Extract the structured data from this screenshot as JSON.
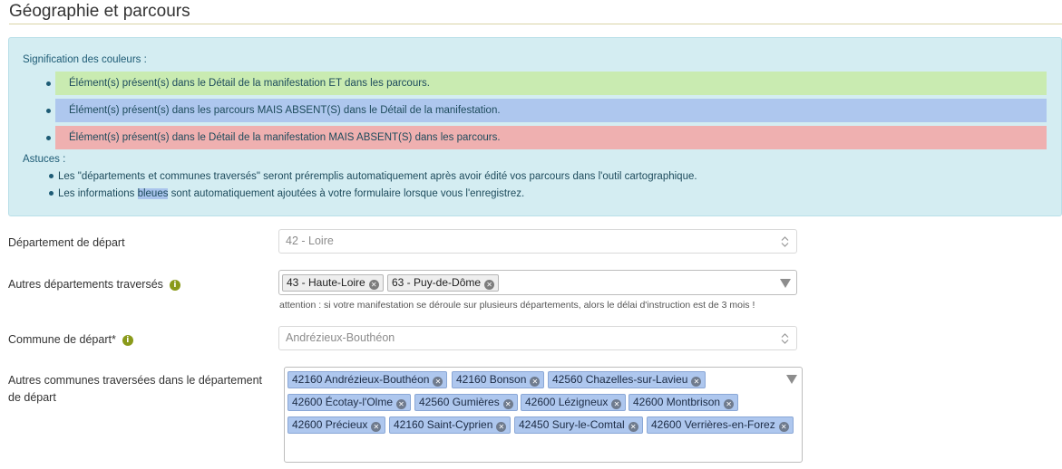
{
  "section": {
    "title": "Géographie et parcours"
  },
  "legend": {
    "heading": "Signification des couleurs :",
    "rows": [
      {
        "text": "Élément(s) présent(s) dans le Détail de la manifestation ET dans les parcours.",
        "color": "#c9ebb1"
      },
      {
        "text": "Élément(s) présent(s) dans les parcours MAIS ABSENT(S) dans le Détail de la manifestation.",
        "color": "#aec7ee"
      },
      {
        "text": "Élément(s) présent(s) dans le Détail de la manifestation MAIS ABSENT(S) dans les parcours.",
        "color": "#efb0b0"
      }
    ]
  },
  "tips": {
    "heading": "Astuces :",
    "items": [
      "Les \"départements et communes traversés\" seront préremplis automatiquement après avoir édité vos parcours dans l'outil cartographique.",
      {
        "before": "Les informations ",
        "highlight": "bleues",
        "after": " sont automatiquement ajoutées à votre formulaire lorsque vous l'enregistrez."
      }
    ]
  },
  "fields": {
    "departement_depart": {
      "label": "Département de départ",
      "value": "42 - Loire"
    },
    "autres_departements": {
      "label": "Autres départements traversés",
      "tags": [
        "43 - Haute-Loire",
        "63 - Puy-de-Dôme"
      ],
      "help": "attention : si votre manifestation se déroule sur plusieurs départements, alors le délai d'instruction est de 3 mois !"
    },
    "commune_depart": {
      "label": "Commune de départ*",
      "value": "Andrézieux-Bouthéon"
    },
    "autres_communes": {
      "label_line1": "Autres communes traversées dans le département",
      "label_line2": "de départ",
      "tags": [
        "42160 Andrézieux-Bouthéon",
        "42160 Bonson",
        "42560 Chazelles-sur-Lavieu",
        "42600 Écotay-l'Olme",
        "42560 Gumières",
        "42600 Lézigneux",
        "42600 Montbrison",
        "42600 Précieux",
        "42160 Saint-Cyprien",
        "42450 Sury-le-Comtal",
        "42600 Verrières-en-Forez"
      ]
    }
  },
  "colors": {
    "accent_info": "#8a9a1a",
    "info_bg": "#d4edf2",
    "tag_blue": "#aec7ee"
  }
}
